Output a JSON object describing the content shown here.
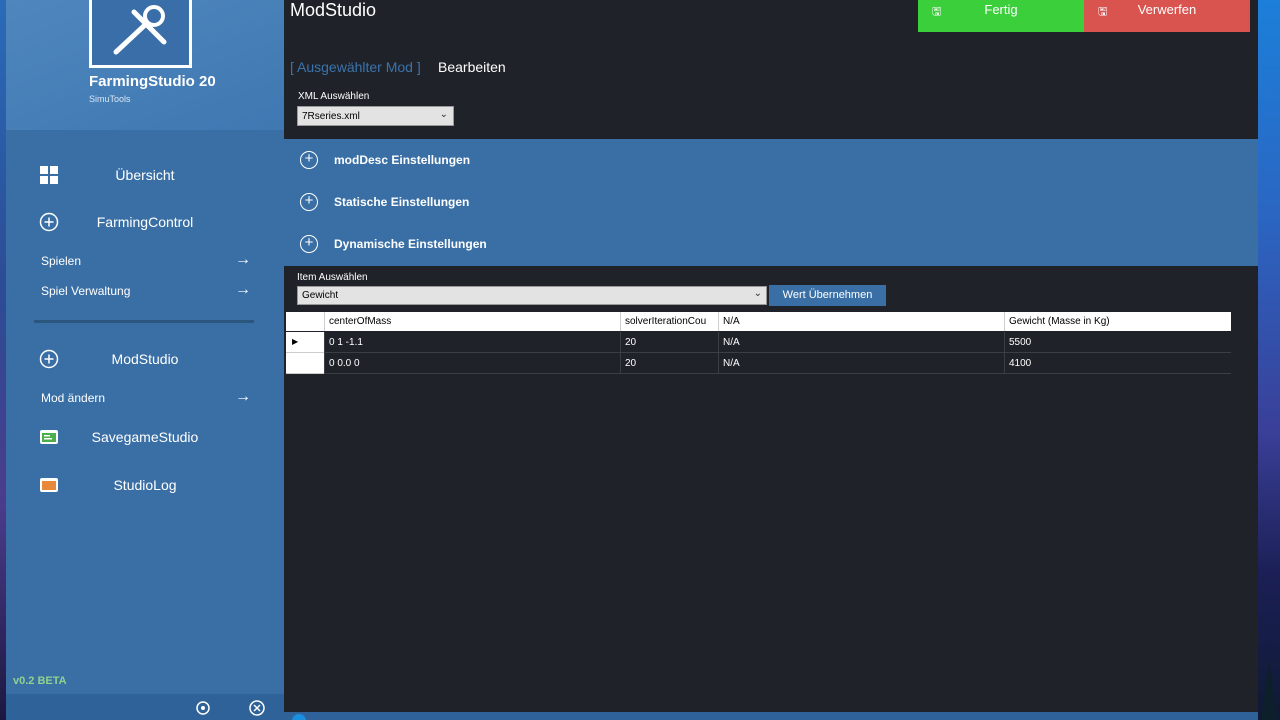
{
  "sidebar": {
    "app_name": "FarmingStudio 20",
    "app_sub": "SimuTools",
    "nav": {
      "uebersicht": "Übersicht",
      "farmingcontrol": "FarmingControl",
      "spielen": "Spielen",
      "spiel_verwaltung": "Spiel Verwaltung",
      "modstudio": "ModStudio",
      "mod_aendern": "Mod ändern",
      "savegamestudio": "SavegameStudio",
      "studiolog": "StudioLog"
    },
    "version": "v0.2 BETA",
    "arrow": "→"
  },
  "main": {
    "title": "ModStudio",
    "fertig": "Fertig",
    "verwerfen": "Verwerfen",
    "crumb_link": "[ Ausgewählter Mod ]",
    "crumb_current": "Bearbeiten",
    "xml_label": "XML Auswählen",
    "xml_value": "7Rseries.xml",
    "accordion": [
      "modDesc Einstellungen",
      "Statische Einstellungen",
      "Dynamische Einstellungen"
    ],
    "item_label": "Item Auswählen",
    "item_value": "Gewicht",
    "apply_button": "Wert Übernehmen"
  },
  "table": {
    "columns": [
      "centerOfMass",
      "solverIterationCou",
      "N/A",
      "Gewicht (Masse in Kg)"
    ],
    "rows": [
      [
        "0 1 -1.1",
        "20",
        "N/A",
        "5500"
      ],
      [
        "0 0.0 0",
        "20",
        "N/A",
        "4100"
      ]
    ],
    "current_row_marker": "▶"
  },
  "colors": {
    "sidebar": "#3a6fa5",
    "main_bg": "#1f2329",
    "fertig": "#3ccf3c",
    "verwerfen": "#d9534f",
    "accent": "#3a6fa5"
  }
}
